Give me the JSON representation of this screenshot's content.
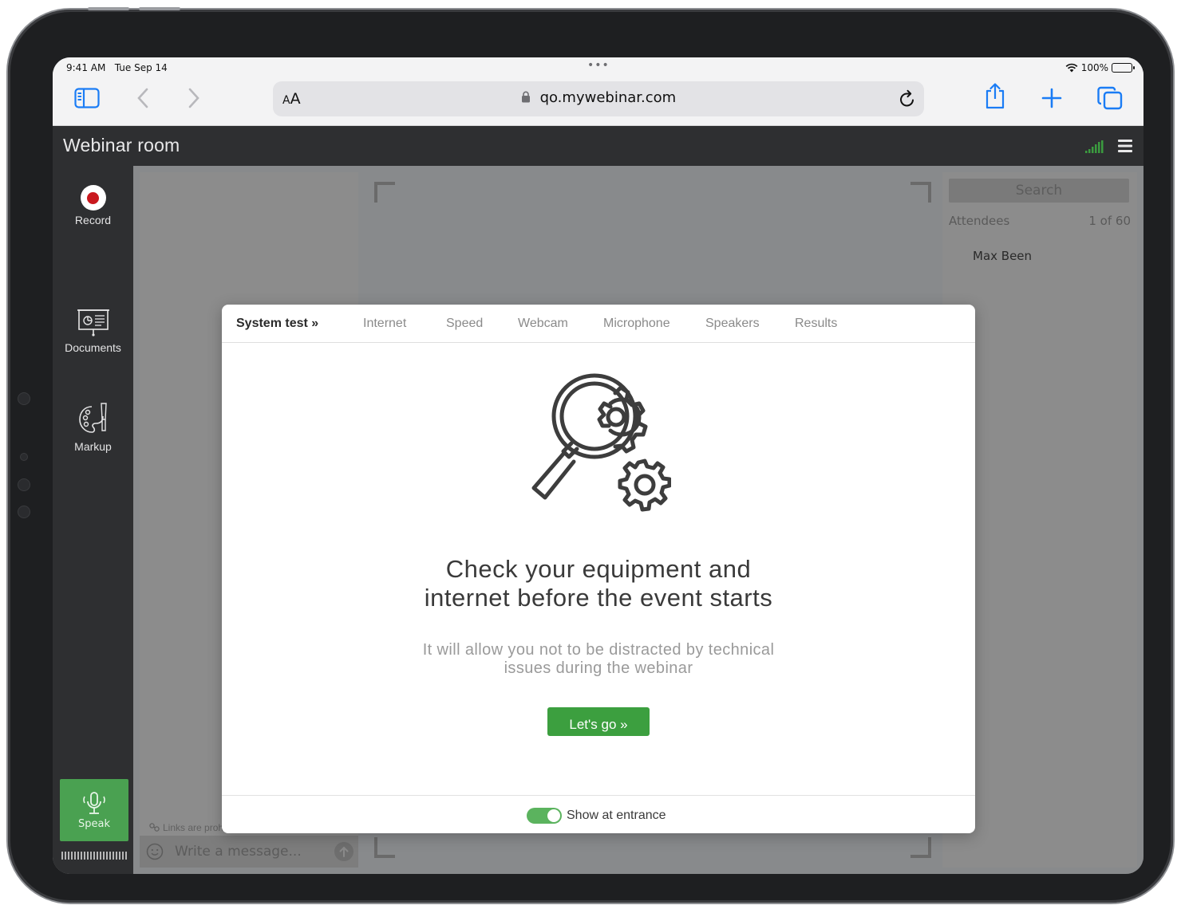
{
  "status_bar": {
    "time": "9:41 AM",
    "date": "Tue Sep 14",
    "battery": "100%"
  },
  "browser": {
    "text_size_small": "A",
    "text_size_large": "A",
    "url": "qo.mywebinar.com"
  },
  "app": {
    "title": "Webinar room",
    "rail": {
      "record": "Record",
      "documents": "Documents",
      "markup": "Markup",
      "speak": "Speak"
    },
    "chat": {
      "links_notice": "Links are prohibited",
      "placeholder": "Write a message..."
    },
    "attendees": {
      "search": "Search",
      "label": "Attendees",
      "count": "1 of 60",
      "items": [
        "Max Been"
      ]
    }
  },
  "modal": {
    "tabs": {
      "system_test": "System test »",
      "internet": "Internet",
      "speed": "Speed",
      "webcam": "Webcam",
      "microphone": "Microphone",
      "speakers": "Speakers",
      "results": "Results"
    },
    "title_line1": "Check your equipment and",
    "title_line2": "internet before the event starts",
    "subtitle_line1": "It will allow you not to be distracted by technical",
    "subtitle_line2": "issues during the webinar",
    "cta": "Let's go »",
    "toggle_label": "Show at entrance",
    "toggle_on": true
  },
  "colors": {
    "accent_green": "#3c9f3f",
    "safari_blue": "#1a7cf5",
    "record_red": "#c9181e"
  }
}
